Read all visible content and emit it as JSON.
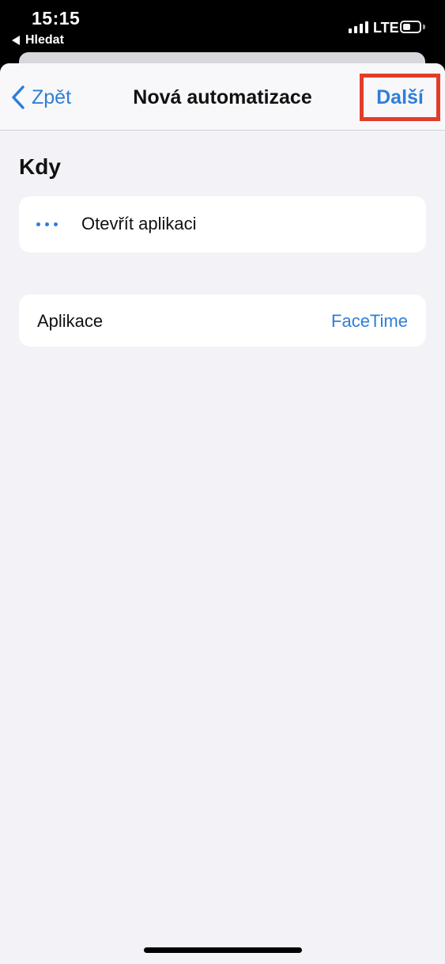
{
  "status_bar": {
    "time": "15:15",
    "back_label": "Hledat",
    "network": "LTE",
    "battery_level": 0.45
  },
  "nav": {
    "back_label": "Zpět",
    "title": "Nová automatizace",
    "next_label": "Další"
  },
  "section": {
    "title": "Kdy"
  },
  "trigger": {
    "label": "Otevřít aplikaci"
  },
  "app_row": {
    "label": "Aplikace",
    "value": "FaceTime"
  },
  "colors": {
    "accent": "#2f7ed8",
    "highlight": "#e23c2a",
    "background": "#f2f2f7"
  }
}
